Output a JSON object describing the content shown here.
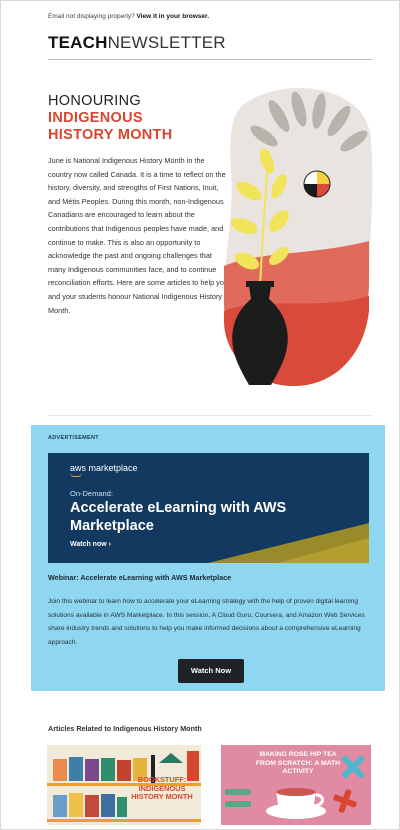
{
  "preheader": {
    "text": "Email not displaying properly?",
    "link": "View it in your browser."
  },
  "brand": {
    "strong": "TEACH",
    "light": "NEWSLETTER"
  },
  "hero": {
    "title_line1": "HONOURING",
    "title_line2": "INDIGENOUS",
    "title_line3": "HISTORY MONTH",
    "body": "June is National Indigenous History Month in the country now called Canada. It is a time to reflect on the history, diversity, and strengths of First Nations, Inuit, and Métis Peoples. During this month, non-Indigenous Canadians are encouraged to learn about the contributions that Indigenous peoples have made, and continue to make. This is also an opportunity to acknowledge the past and ongoing challenges that many Indigenous communities face, and to continue reconciliation efforts. Here are some articles to help you and your students honour National Indigenous History Month."
  },
  "ad": {
    "label": "ADVERTISEMENT",
    "banner": {
      "logo": "aws marketplace",
      "eyebrow": "On-Demand:",
      "title": "Accelerate eLearning with AWS Marketplace",
      "cta": "Watch now ›"
    },
    "heading": "Webinar: Accelerate eLearning with AWS Marketplace",
    "copy": "Join this webinar to learn how to accelerate your eLearning strategy with the help of proven digital learning solutions available in AWS Marketplace. In this session, A Cloud Guru, Coursera, and Amazon Web Services share industry trends and solutions to help you make informed decisions about a comprehensive eLearning approach.",
    "button": "Watch Now"
  },
  "related": {
    "title": "Articles Related to Indigenous History Month",
    "cards": [
      {
        "caption": "BOOKSTUFF: INDIGENOUS HISTORY MONTH"
      },
      {
        "caption": "MAKING ROSE HIP TEA FROM SCRATCH: A MATH ACTIVITY"
      }
    ]
  },
  "colors": {
    "accent_red": "#d8462f",
    "ad_bg": "#8fd6f0",
    "banner_navy": "#12395f",
    "button_dark": "#1f2328"
  }
}
